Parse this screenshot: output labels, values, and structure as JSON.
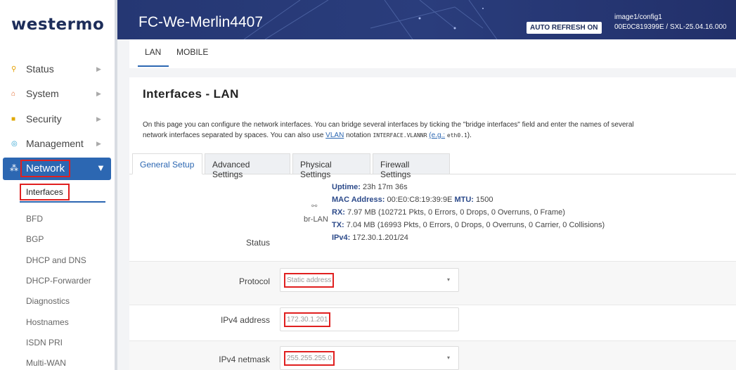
{
  "brand": {
    "logo": "westermo"
  },
  "sidebar": {
    "items": [
      {
        "label": "Status",
        "icon": "status-icon",
        "glyph": "⚲",
        "color": "#e5a000"
      },
      {
        "label": "System",
        "icon": "system-icon",
        "glyph": "⌂",
        "color": "#e06020"
      },
      {
        "label": "Security",
        "icon": "security-icon",
        "glyph": "■",
        "color": "#e0a800"
      },
      {
        "label": "Management",
        "icon": "management-icon",
        "glyph": "◎",
        "color": "#2aa0d0"
      }
    ],
    "network": {
      "label": "Network",
      "icon": "network-icon",
      "glyph": "⁂",
      "arrow": "▼"
    },
    "submenu": {
      "active": "Interfaces",
      "items": [
        "BFD",
        "BGP",
        "DHCP and DNS",
        "DHCP-Forwarder",
        "Diagnostics",
        "Hostnames",
        "ISDN PRI",
        "Multi-WAN"
      ]
    }
  },
  "header": {
    "title": "FC-We-Merlin4407",
    "auto_refresh": "AUTO REFRESH ON",
    "config": "image1/config1",
    "device_info": "00E0C819399E / SXL-25.04.16.000"
  },
  "top_tabs": [
    "LAN",
    "MOBILE"
  ],
  "page": {
    "title": "Interfaces - LAN",
    "desc_line1": "On this page you can configure the network interfaces. You can bridge several interfaces by ticking the \"bridge interfaces\" field and enter the names of several",
    "desc_line2_a": "network interfaces separated by spaces. You can also use",
    "desc_vlan": "VLAN",
    "desc_line2_b": "notation",
    "desc_mono": "INTERFACE.VLANNR",
    "desc_eg": "(e.g.:",
    "desc_eg_val": "eth0.1",
    "desc_end": ")."
  },
  "sub_tabs": [
    "General Setup",
    "Advanced Settings",
    "Physical Settings",
    "Firewall Settings"
  ],
  "status": {
    "label": "Status",
    "device": "br-LAN",
    "device_icon": "bridge-icon",
    "uptime_label": "Uptime:",
    "uptime": "23h 17m 36s",
    "mac_label": "MAC Address:",
    "mac": "00:E0:C8:19:39:9E",
    "mtu_label": "MTU:",
    "mtu": "1500",
    "rx_label": "RX:",
    "rx": "7.97 MB (102721 Pkts, 0 Errors, 0 Drops, 0 Overruns, 0 Frame)",
    "tx_label": "TX:",
    "tx": "7.04 MB (16993 Pkts, 0 Errors, 0 Drops, 0 Overruns, 0 Carrier, 0 Collisions)",
    "ipv4_label": "IPv4:",
    "ipv4": "172.30.1.201/24"
  },
  "fields": {
    "protocol": {
      "label": "Protocol",
      "value": "Static address"
    },
    "ipv4_address": {
      "label": "IPv4 address",
      "value": "172.30.1.201"
    },
    "ipv4_netmask": {
      "label": "IPv4 netmask",
      "value": "255.255.255.0"
    }
  },
  "colors": {
    "accent": "#2c67b2",
    "header": "#253773",
    "highlight": "#e02020"
  }
}
